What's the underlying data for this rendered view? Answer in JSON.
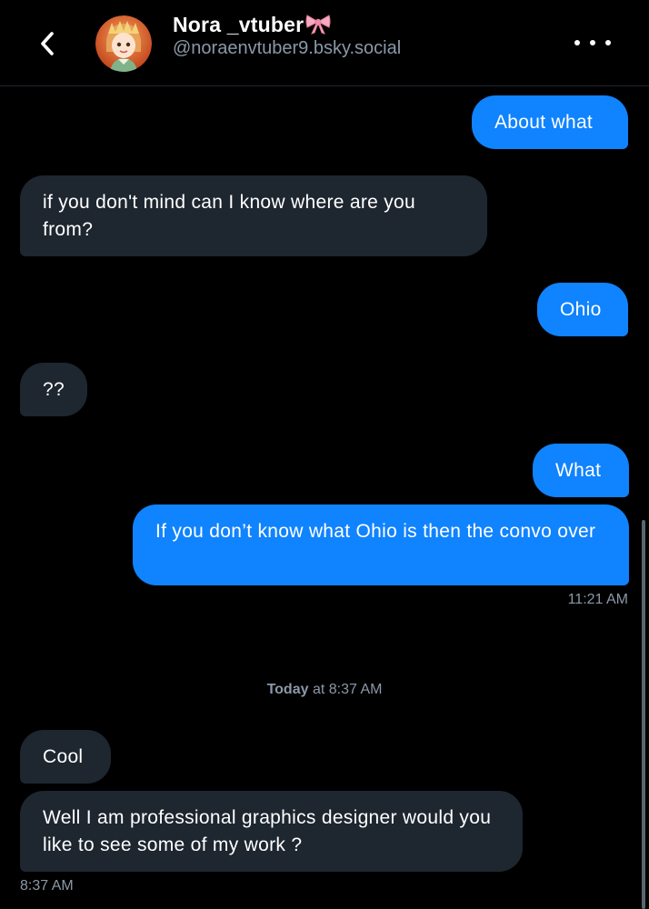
{
  "header": {
    "name": "Nora _vtuber",
    "name_icon": "ribbon-bow-icon",
    "handle": "@noraenvtuber9.bsky.social",
    "back_icon": "chevron-left-icon",
    "more_icon": "more-horizontal-icon"
  },
  "messages": [
    {
      "from": "me",
      "text": "About what"
    },
    {
      "from": "them",
      "text": "if you don't mind can I know where are you from?"
    },
    {
      "from": "me",
      "text": "Ohio"
    },
    {
      "from": "them",
      "text": "??"
    },
    {
      "from": "me",
      "text": "What"
    },
    {
      "from": "me",
      "text": "If you don’t know what Ohio is then the convo over"
    },
    {
      "from": "them",
      "text": "Cool"
    },
    {
      "from": "them",
      "text": "Well I am professional graphics designer would you like to see some of my work ?"
    }
  ],
  "timestamps": {
    "first": "11:21 AM",
    "last": "8:37 AM"
  },
  "divider": {
    "day": "Today",
    "rest": " at 8:37 AM"
  },
  "colors": {
    "sent_bubble": "#1083fe",
    "received_bubble": "#1e2630",
    "background": "#000000",
    "muted_text": "#8b98a8"
  }
}
